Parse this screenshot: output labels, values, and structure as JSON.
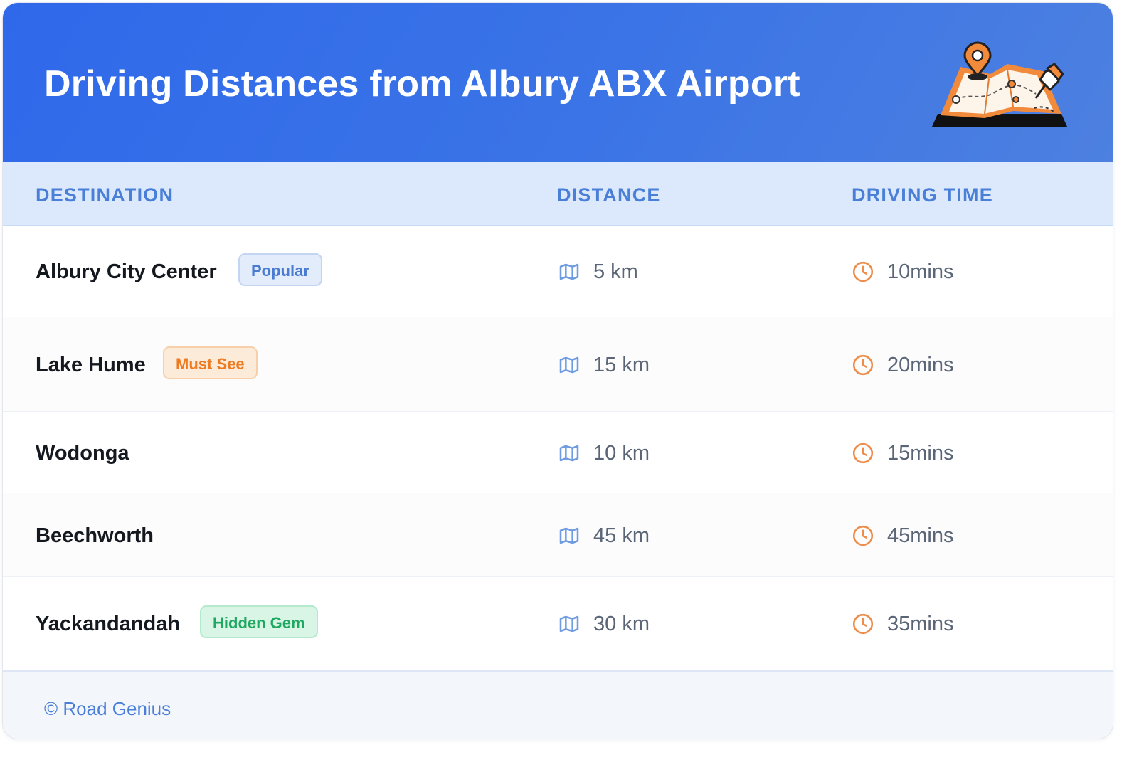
{
  "header": {
    "title": "Driving Distances from Albury ABX Airport",
    "illustration_icon": "map-pin-icon"
  },
  "columns": [
    "DESTINATION",
    "DISTANCE",
    "DRIVING TIME"
  ],
  "rows": [
    {
      "destination": "Albury City Center",
      "badge": "Popular",
      "badge_color": "#4a7bd2",
      "distance": "5 km",
      "time": "10mins"
    },
    {
      "destination": "Lake Hume",
      "badge": "Must See",
      "badge_color": "#ed7b22",
      "distance": "15 km",
      "time": "20mins"
    },
    {
      "destination": "Wodonga",
      "badge": "",
      "distance": "10 km",
      "time": "15mins"
    },
    {
      "destination": "Beechworth",
      "badge": "",
      "distance": "45 km",
      "time": "45mins"
    },
    {
      "destination": "Yackandandah",
      "badge": "Hidden Gem",
      "badge_color": "#1fa861",
      "distance": "30 km",
      "time": "35mins"
    }
  ],
  "icons": {
    "distance": "map-icon",
    "time": "clock-icon"
  },
  "footer": {
    "copyright": "© Road Genius"
  },
  "colors": {
    "header_bg": "#2f69ea",
    "accent": "#4a7fd8",
    "clock": "#ef8c4a"
  }
}
